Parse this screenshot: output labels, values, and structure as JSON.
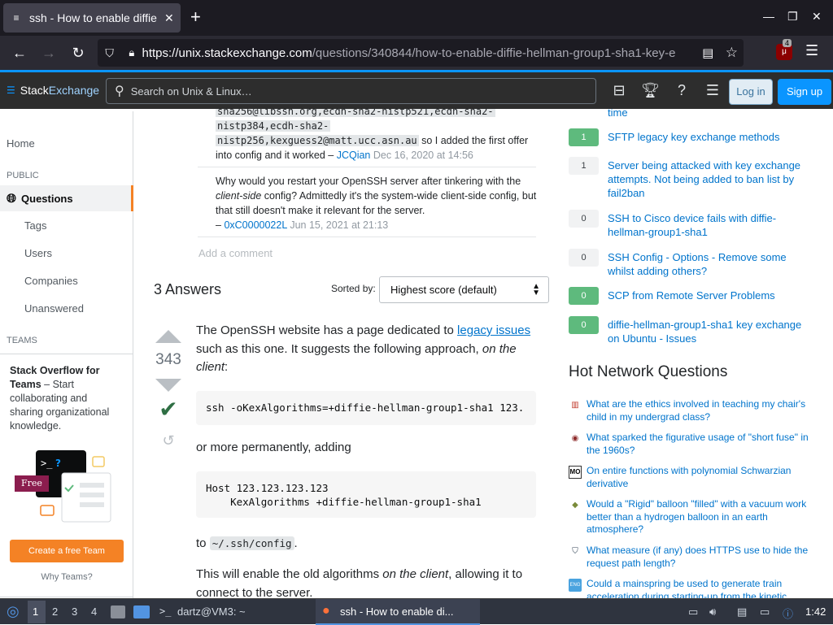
{
  "browser": {
    "tab_title": "ssh - How to enable diffie",
    "new_tab": "+",
    "url_domain": "https://unix.stackexchange.com",
    "url_path": "/questions/340844/how-to-enable-diffie-hellman-group1-sha1-key-e",
    "ext_badge": "4"
  },
  "topbar": {
    "logo_a": "Stack",
    "logo_b": "Exchange",
    "search_placeholder": "Search on Unix & Linux…",
    "login": "Log in",
    "signup": "Sign up"
  },
  "leftnav": {
    "home": "Home",
    "public": "PUBLIC",
    "questions": "Questions",
    "tags": "Tags",
    "users": "Users",
    "companies": "Companies",
    "unanswered": "Unanswered",
    "teams": "TEAMS",
    "teams_title": "Stack Overflow for Teams",
    "teams_desc": " – Start collaborating and sharing organizational knowledge.",
    "free_badge": "Free",
    "create_team": "Create a free Team",
    "why_teams": "Why Teams?"
  },
  "comments": {
    "c1_code_a": "sha256@libssh.org,ecdh-sha2-nistp521,ecdh-sha2-",
    "c1_code_b": "nistp384,ecdh-sha2-",
    "c1_code_c": "nistp256,kexguess2@matt.ucc.asn.au",
    "c1_text": " so I added the first offer into config and it worked – ",
    "c1_user": "JCQian",
    "c1_date": "Dec 16, 2020 at 14:56",
    "c2_text_a": "Why would you restart your OpenSSH server after tinkering with the ",
    "c2_em": "client-side",
    "c2_text_b": " config? Admittedly it's the system-wide client-side config, but that still doesn't make it relevant for the server.",
    "c2_dash": "– ",
    "c2_user": "0xC0000022L",
    "c2_date": "Jun 15, 2021 at 21:13",
    "add_comment": "Add a comment"
  },
  "answers": {
    "heading": "3 Answers",
    "sorted_by": "Sorted by:",
    "sort_value": "Highest score (default)",
    "score": "343",
    "p1_a": "The OpenSSH website has a page dedicated to ",
    "p1_link": "legacy issues",
    "p1_b": " such as this one. It suggests the following approach, ",
    "p1_em": "on the client",
    "p1_c": ":",
    "code1": "ssh -oKexAlgorithms=+diffie-hellman-group1-sha1 123.",
    "p2": "or more permanently, adding",
    "code2": "Host 123.123.123.123\n    KexAlgorithms +diffie-hellman-group1-sha1",
    "p3_a": "to ",
    "p3_code": "~/.ssh/config",
    "p3_b": ".",
    "p4_a": "This will enable the old algorithms ",
    "p4_em": "on the client",
    "p4_b": ", allowing it to connect to the server."
  },
  "related": [
    {
      "count": "",
      "title": "time",
      "style": "none"
    },
    {
      "count": "1",
      "title": "SFTP legacy key exchange methods",
      "style": "green"
    },
    {
      "count": "1",
      "title": "Server being attacked with key exchange attempts. Not being added to ban list by fail2ban",
      "style": "grey"
    },
    {
      "count": "0",
      "title": "SSH to Cisco device fails with diffie-hellman-group1-sha1",
      "style": "grey"
    },
    {
      "count": "0",
      "title": "SSH Config - Options - Remove some whilst adding others?",
      "style": "grey"
    },
    {
      "count": "0",
      "title": "SCP from Remote Server Problems",
      "style": "green"
    },
    {
      "count": "0",
      "title": "diffie-hellman-group1-sha1 key exchange on Ubuntu - Issues",
      "style": "green"
    }
  ],
  "hnq": {
    "heading": "Hot Network Questions",
    "items": [
      {
        "icon": "academia-icon",
        "title": "What are the ethics involved in teaching my chair's child in my undergrad class?"
      },
      {
        "icon": "english-icon",
        "title": "What sparked the figurative usage of \"short fuse\" in the 1960s?"
      },
      {
        "icon": "math-icon",
        "title": "On entire functions with polynomial Schwarzian derivative"
      },
      {
        "icon": "physics-icon",
        "title": "Would a \"Rigid\" balloon \"filled\" with a vacuum work better than a hydrogen balloon in an earth atmosphere?"
      },
      {
        "icon": "security-icon",
        "title": "What measure (if any) does HTTPS use to hide the request path length?"
      },
      {
        "icon": "engineering-icon",
        "title": "Could a mainspring be used to generate train acceleration during starting-up from the kinetic"
      }
    ]
  },
  "taskbar": {
    "ws1": "1",
    "ws2": "2",
    "ws3": "3",
    "ws4": "4",
    "terminal": "dartz@VM3: ~",
    "firefox": "ssh - How to enable di...",
    "clock": "1:42"
  }
}
